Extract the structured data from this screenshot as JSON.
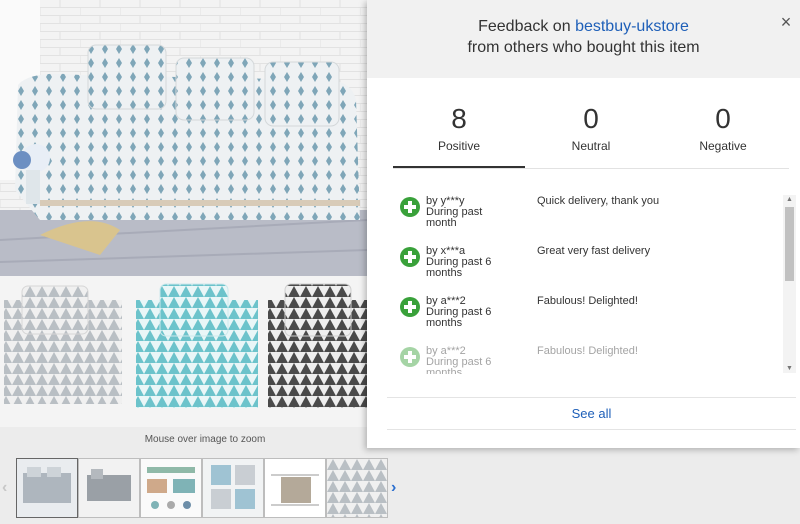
{
  "gallery": {
    "zoom_hint": "Mouse over image to zoom",
    "prev_icon": "chevron-left-icon",
    "next_icon": "chevron-right-icon",
    "thumbnail_count": 6
  },
  "feedback_modal": {
    "title_prefix": "Feedback on",
    "store_name": "bestbuy-ukstore",
    "title_suffix": "from others who bought this item",
    "close_icon": "×",
    "summary": [
      {
        "count": "8",
        "label": "Positive",
        "active": true
      },
      {
        "count": "0",
        "label": "Neutral",
        "active": false
      },
      {
        "count": "0",
        "label": "Negative",
        "active": false
      }
    ],
    "items": [
      {
        "user": "by y***y",
        "time": "During past month",
        "comment": "Quick delivery, thank you"
      },
      {
        "user": "by x***a",
        "time": "During past 6 months",
        "comment": "Great very fast delivery"
      },
      {
        "user": "by a***2",
        "time": "During past 6 months",
        "comment": "Fabulous! Delighted!"
      },
      {
        "user": "by a***2",
        "time": "During past 6 months",
        "comment": "Fabulous! Delighted!"
      }
    ],
    "see_all": "See all",
    "colors": {
      "link": "#1e5fb8",
      "positive": "#39a13a",
      "header_bg": "#f1f1f1"
    }
  }
}
